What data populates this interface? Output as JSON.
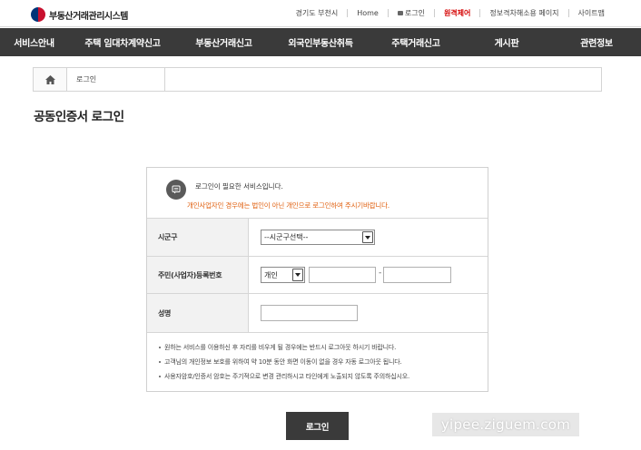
{
  "header": {
    "logo_text": "부동산거래관리시스템",
    "util_links": {
      "region": "경기도 부천시",
      "home": "Home",
      "login": "로그인",
      "remote": "원격제어",
      "accessibility": "정보격차해소용 페이지",
      "sitemap": "사이트맵"
    }
  },
  "nav": {
    "items": [
      {
        "label": "서비스안내"
      },
      {
        "label": "주택 임대차계약신고"
      },
      {
        "label": "부동산거래신고"
      },
      {
        "label": "외국인부동산취득"
      },
      {
        "label": "주택거래신고"
      },
      {
        "label": "게시판"
      },
      {
        "label": "관련정보"
      }
    ]
  },
  "breadcrumb": {
    "home_icon": "home-icon",
    "current": "로그인"
  },
  "page": {
    "title": "공동인증서 로그인"
  },
  "notice": {
    "icon": "notice-icon",
    "line1": "로그인이 필요한 서비스입니다.",
    "line2": "개인사업자인 경우에는 법인이 아닌 개인으로 로그인하여 주시기바랍니다."
  },
  "form": {
    "sigungu": {
      "label": "시군구",
      "selected": "--시군구선택--"
    },
    "resident_no": {
      "label": "주민(사업자)등록번호",
      "type_selected": "개인",
      "part1_value": "",
      "part2_value": "",
      "dash": "-"
    },
    "name": {
      "label": "성명",
      "value": ""
    }
  },
  "notes": [
    "원하는 서비스를 이용하신 후 자리를 비우게 될 경우에는 반드시 로그아웃 하시기 바랍니다.",
    "고객님의 개인정보 보호를 위하여 약 10분 동안 화면 이동이 없을 경우 자동 로그아웃 됩니다.",
    "사용자암호/인증서 암호는 주기적으로 변경 관리하시고 타인에게 노출되지 않도록 주의하십시오."
  ],
  "buttons": {
    "login": "로그인"
  },
  "watermark": "yipee.ziguem.com",
  "colors": {
    "nav_bg": "#3a3a3a",
    "accent_red": "#d40000",
    "notice_orange": "#e06010"
  }
}
